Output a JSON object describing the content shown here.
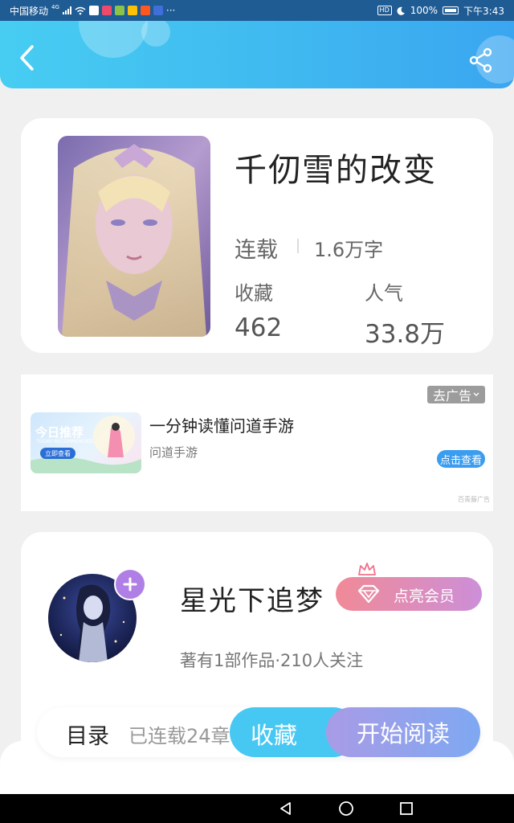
{
  "status_bar": {
    "carrier": "中国移动",
    "signal_type": "4G",
    "more": "···",
    "hd": "HD",
    "battery": "100%",
    "time": "下午3:43"
  },
  "header": {
    "back_icon": "chevron-left-icon",
    "share_icon": "share-icon"
  },
  "book": {
    "title": "千仞雪的改变",
    "status": "连载",
    "word_count": "1.6万字",
    "stats": [
      {
        "label": "收藏",
        "value": "462"
      },
      {
        "label": "人气",
        "value": "33.8万"
      }
    ]
  },
  "ad": {
    "close_label": "去广告",
    "image_title": "今日推荐",
    "image_subtitle": "TODAY RECOMMENDED",
    "image_button": "立即查看",
    "headline": "一分钟读懂问道手游",
    "brand": "问道手游",
    "cta": "点击查看",
    "source": "百青藤广告"
  },
  "author": {
    "name": "星光下追梦",
    "follow_icon": "plus-icon",
    "vip_label": "点亮会员",
    "works": "著有1部作品·210人关注"
  },
  "actions": {
    "toc_label": "目录",
    "chapters": "已连载24章",
    "collect_label": "收藏",
    "read_label": "开始阅读"
  },
  "colors": {
    "header": "#3fb7f0",
    "collect": "#47c8f3",
    "vip_start": "#f18a97",
    "vip_end": "#cc8fd8"
  }
}
